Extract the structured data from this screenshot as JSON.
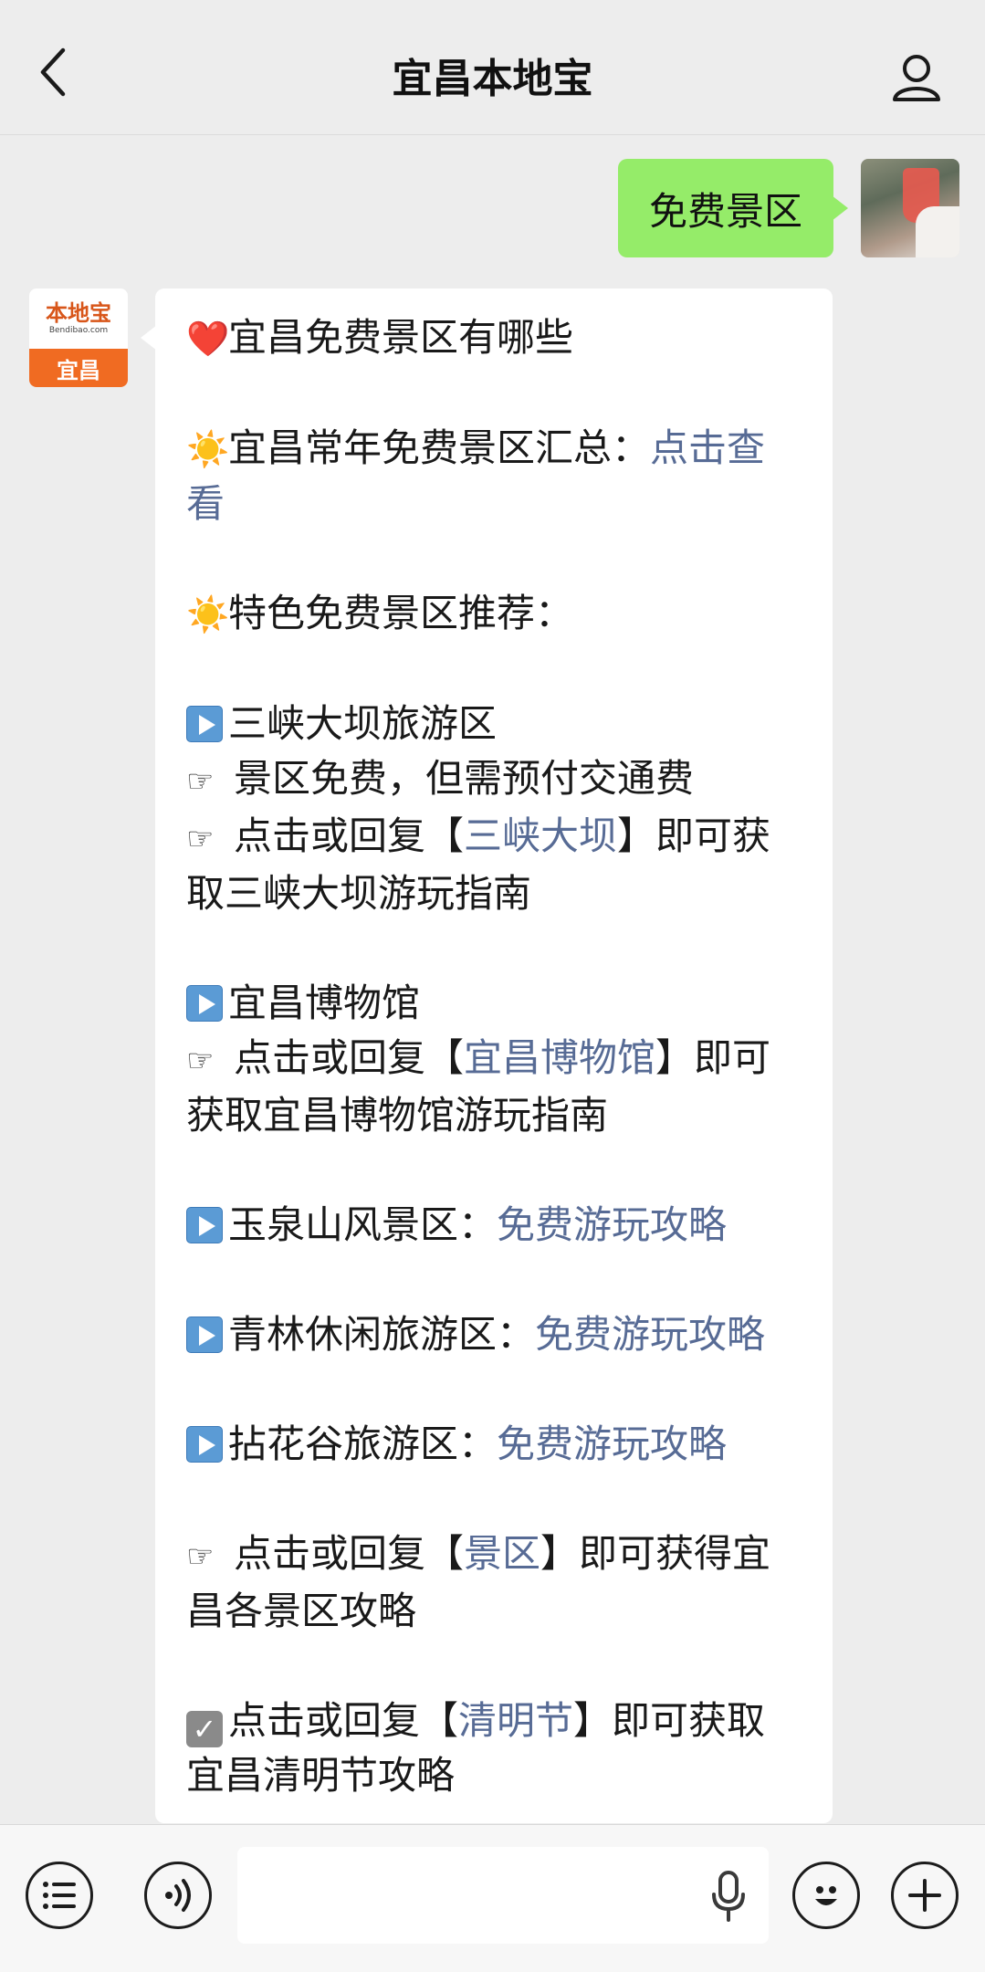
{
  "header": {
    "title": "宜昌本地宝"
  },
  "outgoing": {
    "text": "免费景区"
  },
  "bot": {
    "logo_name": "本地宝",
    "logo_url": "Bendibao.com",
    "logo_city": "宜昌"
  },
  "message": {
    "p1": {
      "emoji": "❤️",
      "text": "宜昌免费景区有哪些"
    },
    "p2": {
      "emoji": "☀️",
      "text": "宜昌常年免费景区汇总：",
      "link": "点击查看"
    },
    "p3": {
      "emoji": "☀️",
      "text": "特色免费景区推荐："
    },
    "p4": {
      "title": "三峡大坝旅游区",
      "line1": "景区免费，但需预付交通费",
      "line2_pre": "点击或回复【",
      "line2_link": "三峡大坝",
      "line2_post": "】即可获取三峡大坝游玩指南"
    },
    "p5": {
      "title": "宜昌博物馆",
      "line_pre": "点击或回复【",
      "line_link": "宜昌博物馆",
      "line_post": "】即可获取宜昌博物馆游玩指南"
    },
    "p6": {
      "text": "玉泉山风景区：",
      "link": "免费游玩攻略"
    },
    "p7": {
      "text": "青林休闲旅游区：",
      "link": "免费游玩攻略"
    },
    "p8": {
      "text": "拈花谷旅游区：",
      "link": "免费游玩攻略"
    },
    "p9": {
      "pre": "点击或回复【",
      "link": "景区",
      "post": "】即可获得宜昌各景区攻略"
    },
    "p10": {
      "pre": "点击或回复【",
      "link": "清明节",
      "post": "】即可获取宜昌清明节攻略"
    }
  },
  "icons": {
    "back": "chevron-left-icon",
    "profile": "person-icon",
    "menu": "list-icon",
    "voice": "voice-icon",
    "mic": "microphone-icon",
    "emoji": "smiley-icon",
    "plus": "plus-icon",
    "hand": "☞"
  },
  "colors": {
    "link": "#576b95",
    "outgoing_bubble": "#95ec69",
    "background": "#ededed"
  }
}
